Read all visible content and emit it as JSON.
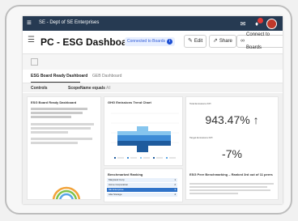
{
  "window": {
    "org_title": "SE - Dept of SE Enterprises"
  },
  "header": {
    "page_title": "PC - ESG Dashboard",
    "connected_badge": "Connected to Boards",
    "edit_label": "Edit",
    "share_label": "Share",
    "connect_label": "Connect to Boards"
  },
  "tabs": [
    {
      "label": "ESG Board Ready Dashboard",
      "active": true
    },
    {
      "label": "GEB Dashboard",
      "active": false
    }
  ],
  "controls": {
    "label": "Controls",
    "filter_label": "ScopeName equals",
    "filter_value": "All"
  },
  "panels": {
    "summary_title": "ESG Board Ready Dashboard",
    "chart_title": "GHG Emissions Trend Chart",
    "total_kpi_label": "Total Emissions KPI",
    "total_kpi_value": "943.47% ↑",
    "target_kpi_label": "Target Emissions KPI",
    "target_kpi_value": "-7%",
    "ranking_title": "Benchmarked Ranking",
    "benchmark_title": "ESG Peer Benchmarking – Ranked 3rd out of 11 peers"
  },
  "ranking_rows": [
    {
      "name": "Maryland Corp",
      "value": "1"
    },
    {
      "name": "Acme Corporation",
      "value": "2"
    },
    {
      "name": "SE Enterprise",
      "value": "3"
    },
    {
      "name": "Alta Storage",
      "value": "4"
    }
  ],
  "colors": {
    "topbar": "#263a52",
    "accent_blue": "#2e5bd8",
    "chart_dark": "#1e5b9d",
    "chart_mid": "#3d8bd6",
    "chart_light": "#86c5ee",
    "ranking_highlight": "#2f73c9",
    "gauge_orange": "#f2a33a",
    "gauge_green": "#7fc24a",
    "gauge_blue": "#5aa6e6"
  }
}
